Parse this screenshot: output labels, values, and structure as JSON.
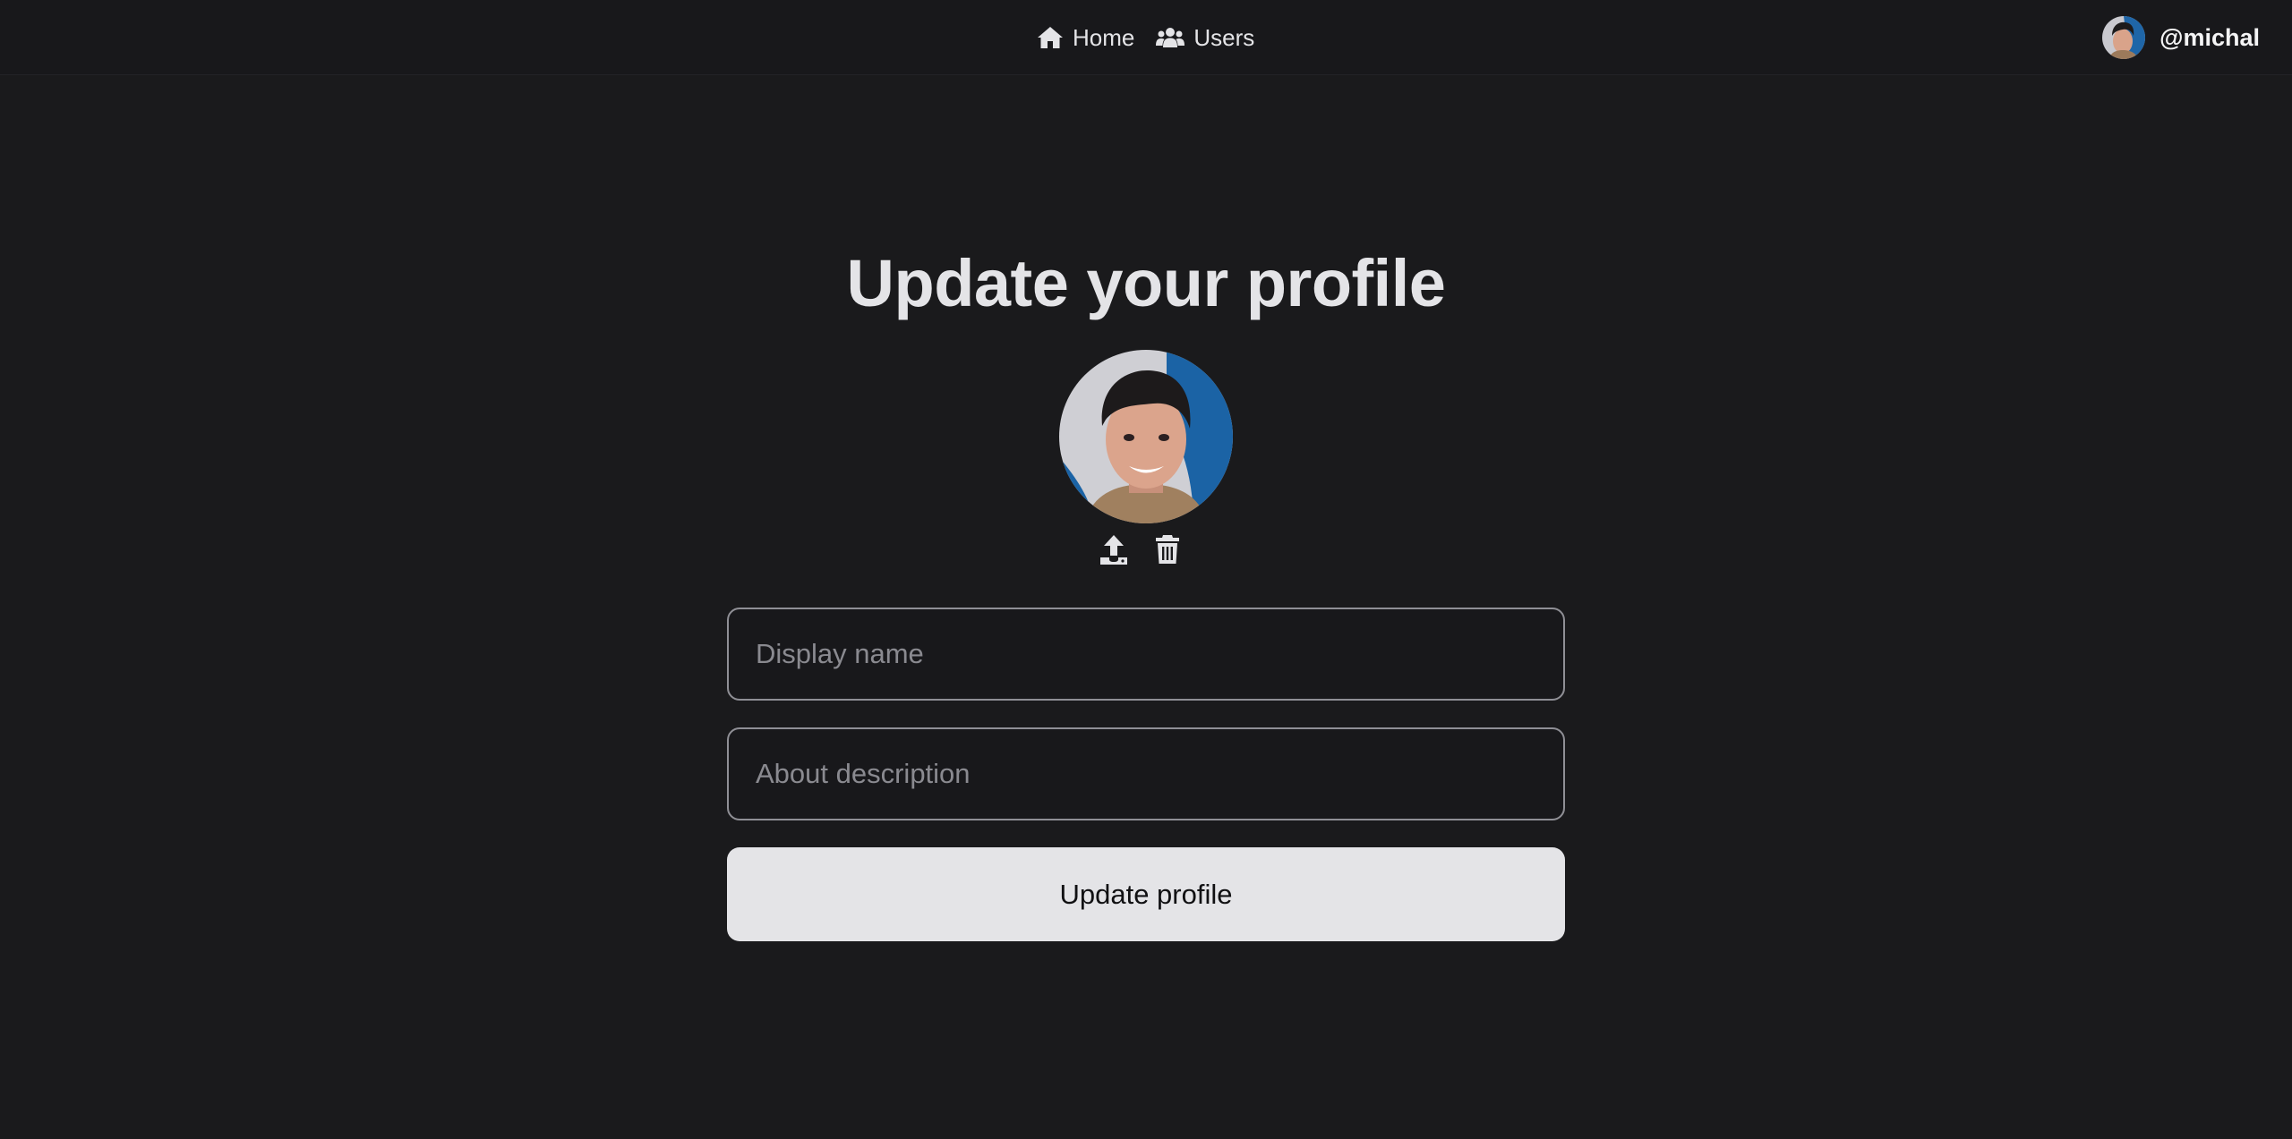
{
  "nav": {
    "items": [
      {
        "label": "Home",
        "icon": "home-icon"
      },
      {
        "label": "Users",
        "icon": "users-icon"
      }
    ]
  },
  "user": {
    "handle": "@michal"
  },
  "page": {
    "title": "Update your profile"
  },
  "avatar": {
    "actions": [
      "upload-icon",
      "trash-icon"
    ]
  },
  "form": {
    "display_name": {
      "placeholder": "Display name",
      "value": ""
    },
    "about": {
      "placeholder": "About description",
      "value": ""
    },
    "submit_label": "Update profile"
  },
  "colors": {
    "background": "#1a1a1c",
    "topbar": "#18181b",
    "text": "#e4e4e7",
    "field_border": "#8f8f95",
    "button_bg": "#e4e4e7"
  }
}
